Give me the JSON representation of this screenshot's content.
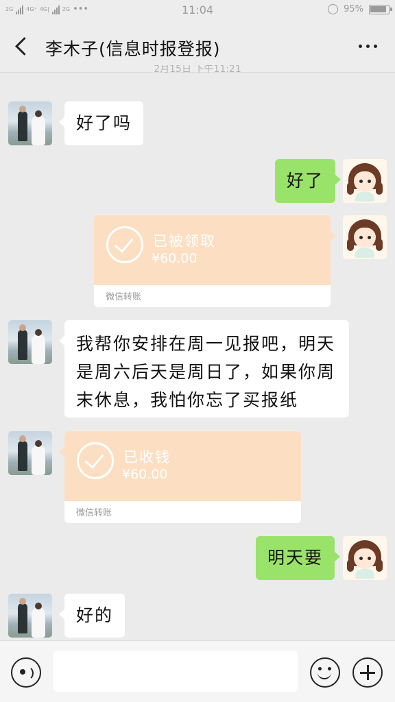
{
  "status_bar": {
    "signal_left": "2G",
    "network_a": "4G⁺",
    "network_b": "4G|",
    "network_c": "2G",
    "dots": "•••",
    "time": "11:04",
    "battery_percent": "95%"
  },
  "header": {
    "title": "李木子(信息时报登报)",
    "back_icon": "chevron-left-icon",
    "more_icon": "more-horizontal-icon"
  },
  "timestamp": "2月15日 下午11:21",
  "messages": [
    {
      "side": "left",
      "type": "text",
      "text": "好了吗"
    },
    {
      "side": "right",
      "type": "text",
      "text": "好了"
    },
    {
      "side": "right",
      "type": "transfer",
      "status": "已被领取",
      "amount": "¥60.00",
      "footer": "微信转账"
    },
    {
      "side": "left",
      "type": "text",
      "lines": [
        "我帮你安排在周一见报吧，明天",
        "是周六后天是周日了，如果你周",
        "末休息，我怕你忘了买报纸"
      ]
    },
    {
      "side": "left",
      "type": "transfer",
      "status": "已收钱",
      "amount": "¥60.00",
      "footer": "微信转账"
    },
    {
      "side": "right",
      "type": "text",
      "text": "明天要"
    },
    {
      "side": "left",
      "type": "text",
      "text": "好的"
    }
  ],
  "input_bar": {
    "voice_icon": "voice-icon",
    "emoji_icon": "emoji-icon",
    "plus_icon": "plus-icon"
  },
  "colors": {
    "background": "#ebebeb",
    "bubble_self": "#9ae36a",
    "bubble_other": "#ffffff",
    "transfer": "#fcdfc2"
  }
}
